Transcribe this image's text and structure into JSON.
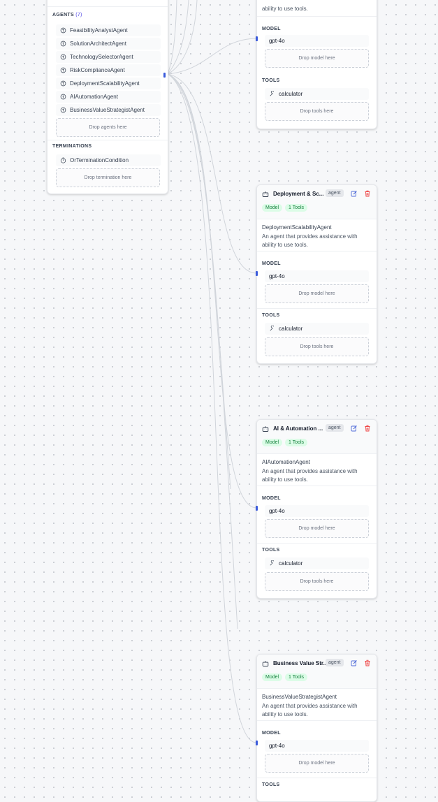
{
  "team": {
    "agents_label": "AGENTS",
    "agents_count": "(7)",
    "agents": [
      "FeasibilityAnalystAgent",
      "SolutionArchitectAgent",
      "TechnologySelectorAgent",
      "RiskComplianceAgent",
      "DeploymentScalabilityAgent",
      "AIAutomationAgent",
      "BusinessValueStrategistAgent"
    ],
    "drop_agents": "Drop agents here",
    "terminations_label": "TERMINATIONS",
    "termination": "OrTerminationCondition",
    "drop_termination": "Drop termination here"
  },
  "top_card": {
    "desc_tail": "ability to use tools.",
    "model_label": "MODEL",
    "model": "gpt-4o",
    "drop_model": "Drop model here",
    "tools_label": "TOOLS",
    "tool": "calculator",
    "drop_tools": "Drop tools here"
  },
  "agent_cards": [
    {
      "title": "Deployment & Sc...",
      "badge": "agent",
      "model_pill": "Model",
      "tools_pill": "1 Tools",
      "name": "DeploymentScalabilityAgent",
      "description": "An agent that provides assistance with ability to use tools.",
      "model_label": "MODEL",
      "model": "gpt-4o",
      "drop_model": "Drop model here",
      "tools_label": "TOOLS",
      "tool": "calculator",
      "drop_tools": "Drop tools here"
    },
    {
      "title": "AI & Automation ...",
      "badge": "agent",
      "model_pill": "Model",
      "tools_pill": "1 Tools",
      "name": "AIAutomationAgent",
      "description": "An agent that provides assistance with ability to use tools.",
      "model_label": "MODEL",
      "model": "gpt-4o",
      "drop_model": "Drop model here",
      "tools_label": "TOOLS",
      "tool": "calculator",
      "drop_tools": "Drop tools here"
    },
    {
      "title": "Business Value Str...",
      "badge": "agent",
      "model_pill": "Model",
      "tools_pill": "1 Tools",
      "name": "BusinessValueStrategistAgent",
      "description": "An agent that provides assistance with ability to use tools.",
      "model_label": "MODEL",
      "model": "gpt-4o",
      "drop_model": "Drop model here",
      "tools_label": "TOOLS"
    }
  ],
  "colors": {
    "accent": "#4f46e5",
    "edit_icon": "#4f6bd8",
    "delete_icon": "#ef4444",
    "pill_bg": "#dcfce7",
    "pill_text": "#15803d"
  }
}
